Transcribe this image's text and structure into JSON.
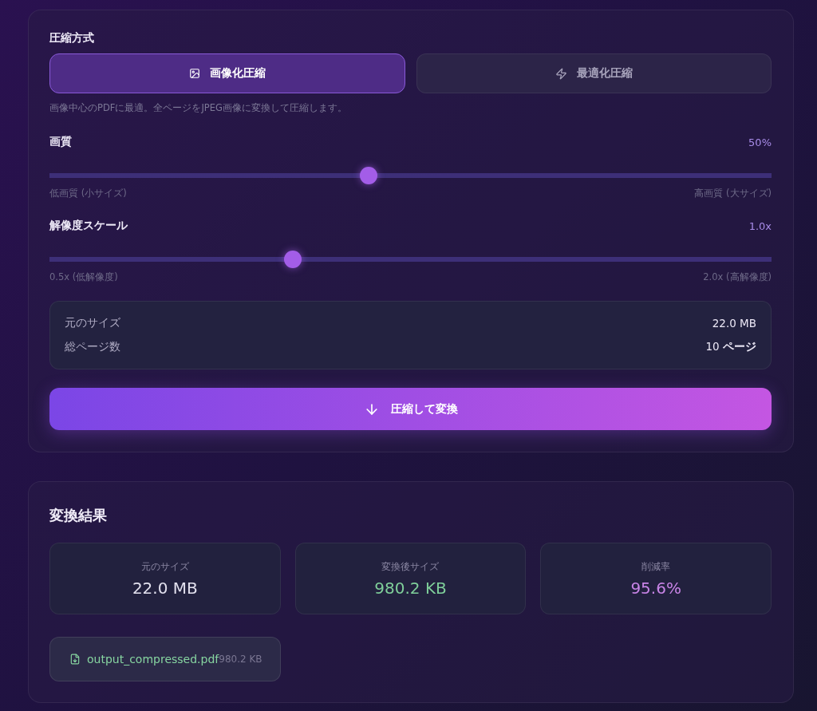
{
  "settings": {
    "mode_label": "圧縮方式",
    "modes": [
      {
        "kind": "image",
        "label": "画像化圧縮",
        "selected": true
      },
      {
        "kind": "optimize",
        "label": "最適化圧縮",
        "selected": false
      }
    ],
    "mode_description": "画像中心のPDFに最適。全ページをJPEG画像に変換して圧縮します。",
    "sliders": [
      {
        "label": "画質",
        "reading": "50%",
        "level": 0.44,
        "min_label": "低画質 (小サイズ)",
        "max_label": "高画質 (大サイズ)"
      },
      {
        "label": "解像度スケール",
        "reading": "1.0x",
        "level": 0.333,
        "min_label": "0.5x (低解像度)",
        "max_label": "2.0x (高解像度)"
      }
    ],
    "info": [
      {
        "label": "元のサイズ",
        "value": "22.0 MB"
      },
      {
        "label": "総ページ数",
        "value": "10 **ページ**"
      }
    ],
    "convert_button": "圧縮して変換"
  },
  "result": {
    "title": "変換結果",
    "stats": [
      {
        "label": "元のサイズ",
        "value": "22.0 MB",
        "color": "#e2e0ee"
      },
      {
        "label": "変換後サイズ",
        "value": "980.2 KB",
        "color": "#7fcf9a"
      },
      {
        "label": "削減率",
        "value": "95.6%",
        "color": "#c884e6"
      }
    ],
    "file": {
      "name": "output_compressed.pdf",
      "size": "980.2 KB"
    }
  }
}
